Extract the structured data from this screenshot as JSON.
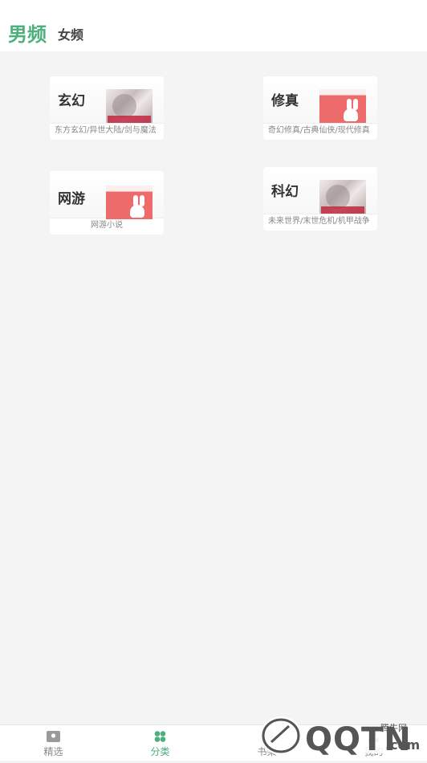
{
  "header": {
    "tab_male": "男频",
    "tab_female": "女频"
  },
  "categories": [
    {
      "name": "玄幻",
      "desc": "东方玄幻/异世大陆/剑与魔法",
      "thumb": "girl-cover"
    },
    {
      "name": "修真",
      "desc": "奇幻修真/古典仙侠/现代修真",
      "thumb": "bunny-cover"
    },
    {
      "name": "网游",
      "desc": "网游小说",
      "thumb": "bunny-cover"
    },
    {
      "name": "科幻",
      "desc": "未来世界/末世危机/机甲战争",
      "thumb": "girl-cover"
    }
  ],
  "nav": [
    {
      "label": "精选",
      "icon": "shop-icon"
    },
    {
      "label": "分类",
      "icon": "clover-icon"
    },
    {
      "label": "书架",
      "icon": "book-icon"
    },
    {
      "label": "我的",
      "icon": "user-icon"
    }
  ],
  "watermark": {
    "logo_text": "QQTN",
    "domain": ".com",
    "site_name": "腾牛网"
  },
  "colors": {
    "accent": "#4caf7d",
    "background": "#f4f4f4"
  }
}
